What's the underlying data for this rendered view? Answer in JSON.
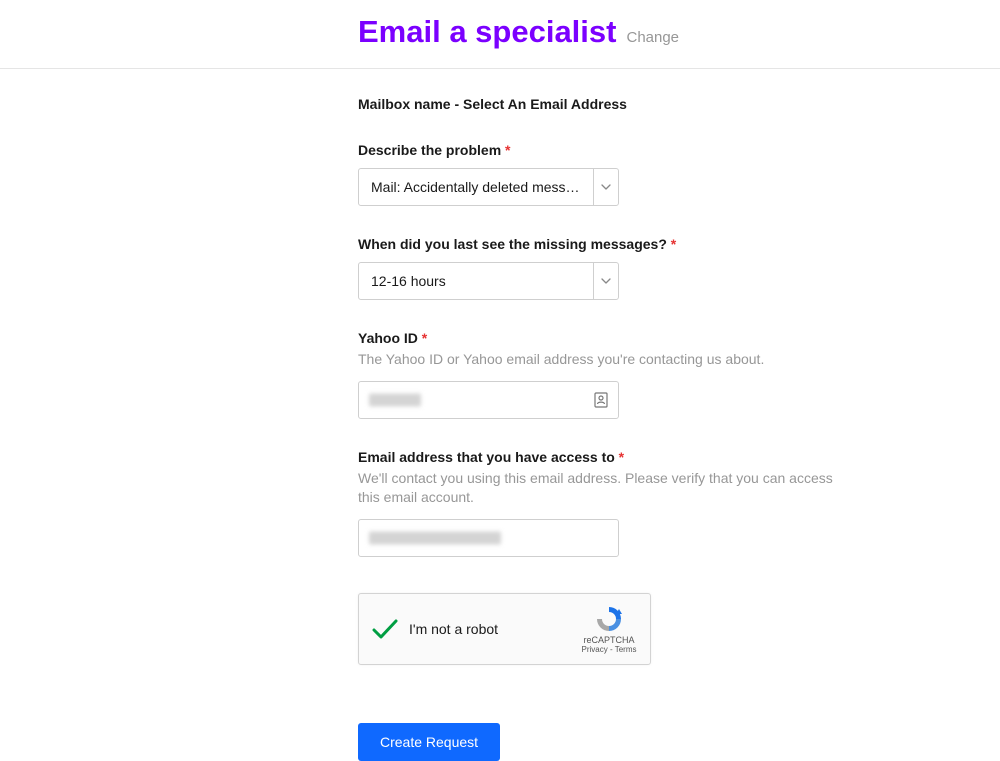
{
  "header": {
    "title": "Email a specialist",
    "change_label": "Change"
  },
  "mailbox_line": "Mailbox name - Select An Email Address",
  "fields": {
    "problem": {
      "label": "Describe the problem",
      "selected": "Mail: Accidentally deleted messa…"
    },
    "last_seen": {
      "label": "When did you last see the missing messages?",
      "selected": "12-16 hours"
    },
    "yahoo_id": {
      "label": "Yahoo ID",
      "hint": "The Yahoo ID or Yahoo email address you're contacting us about."
    },
    "contact_email": {
      "label": "Email address that you have access to",
      "hint": "We'll contact you using this email address. Please verify that you can access this email account."
    }
  },
  "recaptcha": {
    "label": "I'm not a robot",
    "brand": "reCAPTCHA",
    "terms": "Privacy - Terms"
  },
  "submit_label": "Create Request",
  "required_marker": "*"
}
